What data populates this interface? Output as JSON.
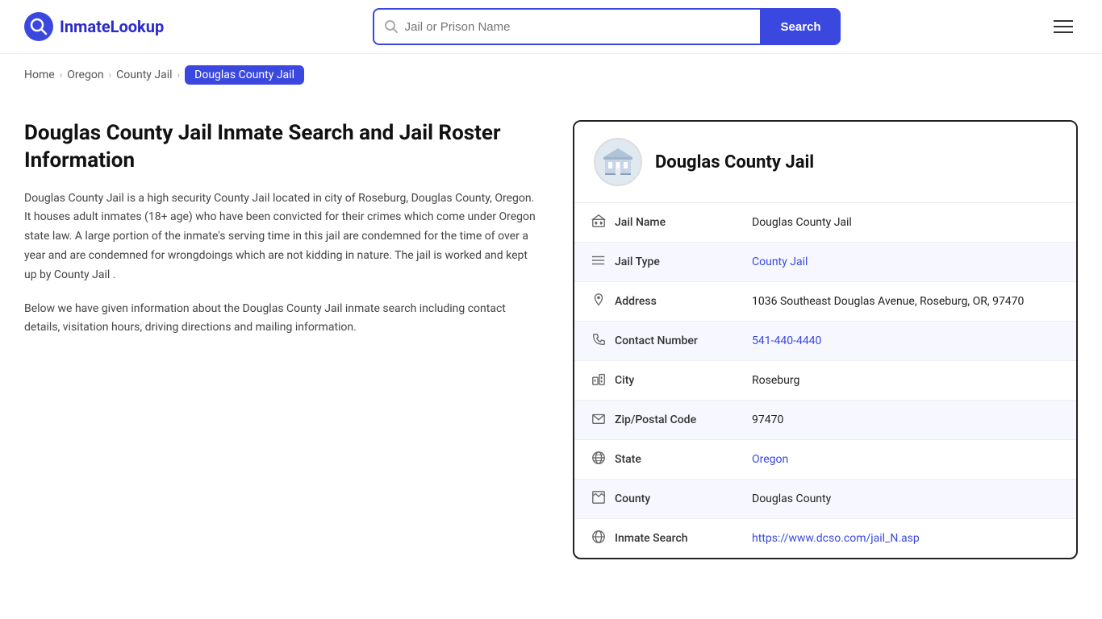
{
  "header": {
    "logo_text": "InmateLookup",
    "search_placeholder": "Jail or Prison Name",
    "search_button_label": "Search"
  },
  "breadcrumb": {
    "home": "Home",
    "state": "Oregon",
    "category": "County Jail",
    "current": "Douglas County Jail"
  },
  "left": {
    "title": "Douglas County Jail Inmate Search and Jail Roster Information",
    "description1": "Douglas County Jail is a high security County Jail located in city of Roseburg, Douglas County, Oregon. It houses adult inmates (18+ age) who have been convicted for their crimes which come under Oregon state law. A large portion of the inmate's serving time in this jail are condemned for the time of over a year and are condemned for wrongdoings which are not kidding in nature. The jail is worked and kept up by County Jail .",
    "description2": "Below we have given information about the Douglas County Jail inmate search including contact details, visitation hours, driving directions and mailing information."
  },
  "card": {
    "title": "Douglas County Jail",
    "rows": [
      {
        "icon": "jail-icon",
        "label": "Jail Name",
        "value": "Douglas County Jail",
        "link": null
      },
      {
        "icon": "list-icon",
        "label": "Jail Type",
        "value": "County Jail",
        "link": "#"
      },
      {
        "icon": "pin-icon",
        "label": "Address",
        "value": "1036 Southeast Douglas Avenue, Roseburg, OR, 97470",
        "link": null
      },
      {
        "icon": "phone-icon",
        "label": "Contact Number",
        "value": "541-440-4440",
        "link": "tel:541-440-4440"
      },
      {
        "icon": "city-icon",
        "label": "City",
        "value": "Roseburg",
        "link": null
      },
      {
        "icon": "mail-icon",
        "label": "Zip/Postal Code",
        "value": "97470",
        "link": null
      },
      {
        "icon": "globe-icon",
        "label": "State",
        "value": "Oregon",
        "link": "#"
      },
      {
        "icon": "county-icon",
        "label": "County",
        "value": "Douglas County",
        "link": null
      },
      {
        "icon": "search-globe-icon",
        "label": "Inmate Search",
        "value": "https://www.dcso.com/jail_N.asp",
        "link": "https://www.dcso.com/jail_N.asp"
      }
    ]
  }
}
